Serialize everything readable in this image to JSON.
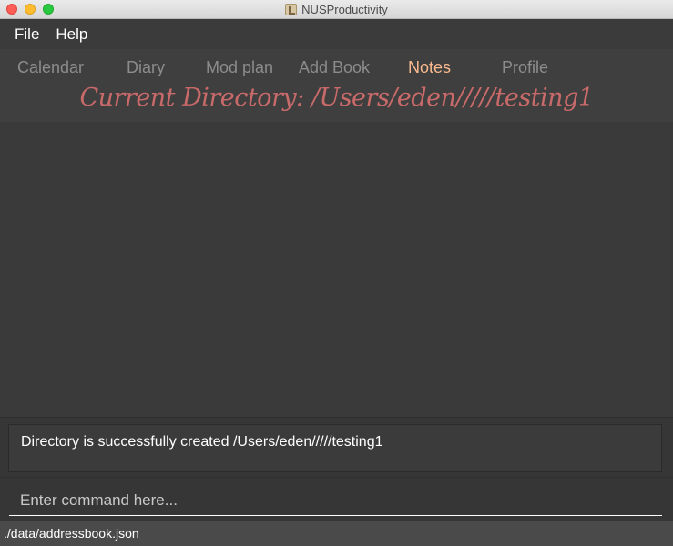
{
  "window": {
    "title": "NUSProductivity"
  },
  "menu": {
    "items": [
      {
        "label": "File"
      },
      {
        "label": "Help"
      }
    ]
  },
  "tabs": {
    "items": [
      {
        "label": "Calendar"
      },
      {
        "label": "Diary"
      },
      {
        "label": "Mod plan"
      },
      {
        "label": "Add Book"
      },
      {
        "label": "Notes"
      },
      {
        "label": "Profile"
      }
    ],
    "active": "Notes"
  },
  "directory": {
    "current": "Current Directory: /Users/eden/////testing1"
  },
  "result": {
    "message": "Directory is successfully created /Users/eden/////testing1"
  },
  "command": {
    "placeholder": "Enter command here...",
    "value": ""
  },
  "status": {
    "file_path": "./data/addressbook.json"
  },
  "colors": {
    "background": "#3b3b3b",
    "active_tab": "#f8b98f",
    "inactive_tab": "#8c8c8c",
    "directory_text": "#c96a6a"
  }
}
